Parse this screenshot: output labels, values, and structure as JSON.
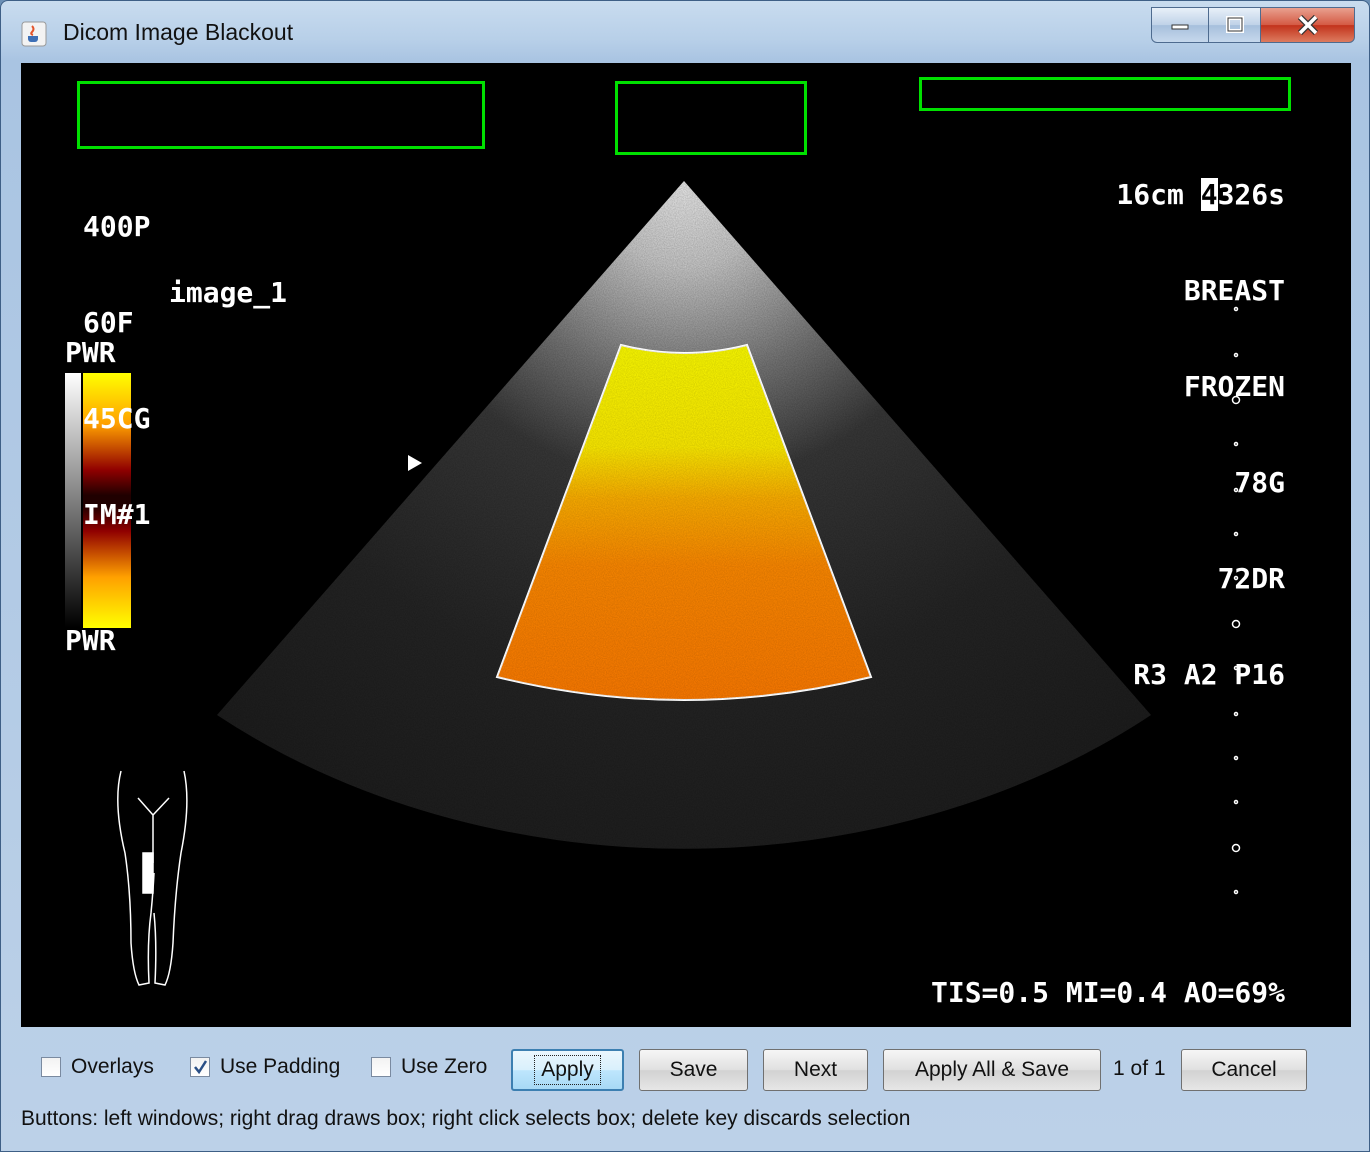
{
  "window": {
    "title": "Dicom Image Blackout",
    "icon": "java-cup-icon",
    "controls": [
      "minimize",
      "maximize",
      "close"
    ]
  },
  "image": {
    "top_left": [
      "400P",
      "60F",
      "45CG",
      "IM#1"
    ],
    "image_name": "image_1",
    "top_right": {
      "line1_a": "16cm ",
      "line1_cursor": "4",
      "line1_b": "326s",
      "lines": [
        "BREAST",
        "FROZEN",
        "78G",
        "72DR",
        "R3 A2 P16"
      ]
    },
    "colorbar_top": "PWR",
    "colorbar_bottom": "PWR",
    "bottom_readout": "TIS=0.5 MI=0.4 AO=69%",
    "blackout_box_color": "#00e000",
    "doppler_colors": [
      "#ffff00",
      "#ff8c00"
    ]
  },
  "controls": {
    "overlays": {
      "label": "Overlays",
      "checked": false
    },
    "use_padding": {
      "label": "Use Padding",
      "checked": true
    },
    "use_zero": {
      "label": "Use Zero",
      "checked": false
    },
    "apply": "Apply",
    "save": "Save",
    "next": "Next",
    "apply_all_save": "Apply All & Save",
    "page_count": "1 of 1",
    "cancel": "Cancel"
  },
  "status": "Buttons: left windows; right drag draws box; right click selects box; delete key discards selection"
}
